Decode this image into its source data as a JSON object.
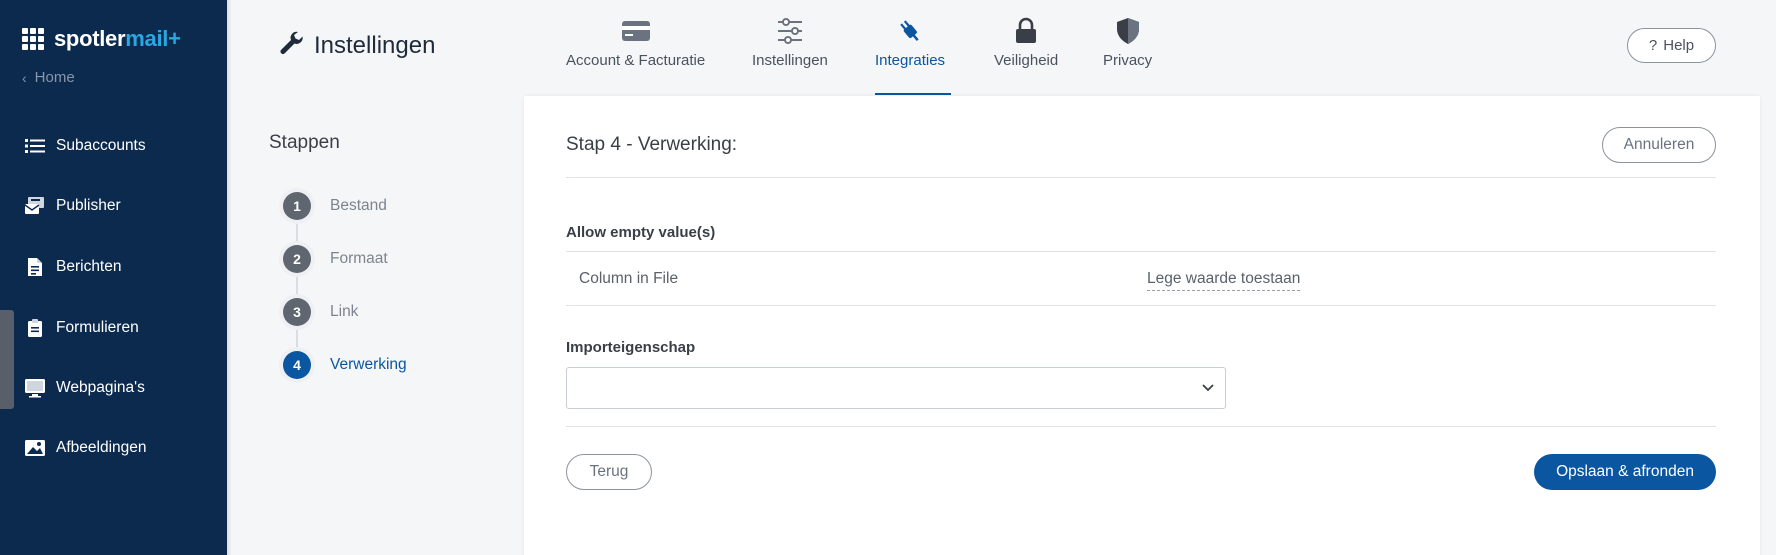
{
  "brand": {
    "name_part1": "spotler",
    "name_part2": "mail+"
  },
  "sidebar": {
    "home_label": "Home",
    "items": [
      {
        "label": "Subaccounts",
        "icon": "list-icon"
      },
      {
        "label": "Publisher",
        "icon": "publisher-icon"
      },
      {
        "label": "Berichten",
        "icon": "document-icon"
      },
      {
        "label": "Formulieren",
        "icon": "clipboard-icon"
      },
      {
        "label": "Webpagina's",
        "icon": "monitor-icon"
      },
      {
        "label": "Afbeeldingen",
        "icon": "image-icon"
      }
    ]
  },
  "header": {
    "title": "Instellingen",
    "tabs": [
      {
        "label": "Account & Facturatie",
        "icon": "credit-card-icon"
      },
      {
        "label": "Instellingen",
        "icon": "sliders-icon"
      },
      {
        "label": "Integraties",
        "icon": "plug-icon",
        "active": true
      },
      {
        "label": "Veiligheid",
        "icon": "lock-icon"
      },
      {
        "label": "Privacy",
        "icon": "shield-icon"
      }
    ],
    "help_label": "Help",
    "help_glyph": "?"
  },
  "steps": {
    "title": "Stappen",
    "items": [
      {
        "number": "1",
        "label": "Bestand"
      },
      {
        "number": "2",
        "label": "Formaat"
      },
      {
        "number": "3",
        "label": "Link"
      },
      {
        "number": "4",
        "label": "Verwerking",
        "active": true
      }
    ]
  },
  "main": {
    "title": "Stap 4 - Verwerking:",
    "cancel_label": "Annuleren",
    "allow_empty": {
      "section_label": "Allow empty value(s)",
      "columns": [
        "Column in File",
        "Lege waarde toestaan"
      ]
    },
    "import_property": {
      "label": "Importeigenschap",
      "value": ""
    },
    "back_label": "Terug",
    "submit_label": "Opslaan & afronden"
  },
  "colors": {
    "sidebar_bg": "#0c2a4d",
    "accent": "#0a56a0",
    "brand_accent": "#29a7e1",
    "page_bg": "#f5f6f8"
  }
}
